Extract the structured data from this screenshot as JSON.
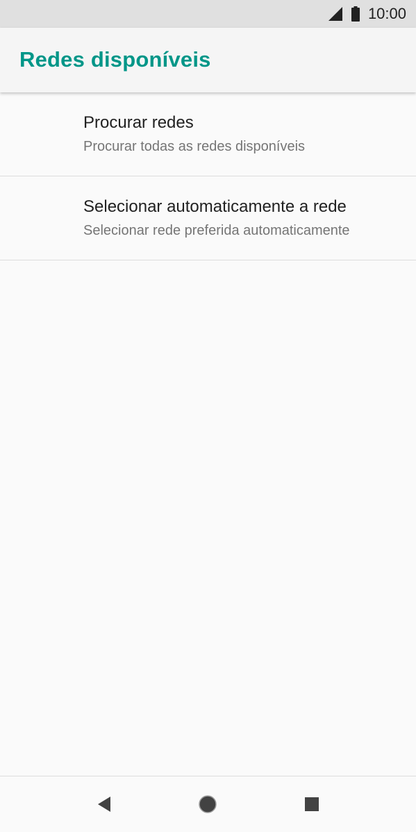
{
  "status_bar": {
    "time": "10:00",
    "icons": [
      "signal-icon",
      "battery-icon"
    ]
  },
  "app_bar": {
    "title": "Redes disponíveis",
    "accent_color": "#009688"
  },
  "list": {
    "items": [
      {
        "title": "Procurar redes",
        "subtitle": "Procurar todas as redes disponíveis"
      },
      {
        "title": "Selecionar automaticamente a rede",
        "subtitle": "Selecionar rede preferida automaticamente"
      }
    ]
  },
  "nav_bar": {
    "icons": [
      "back-icon",
      "home-icon",
      "recent-apps-icon"
    ]
  }
}
